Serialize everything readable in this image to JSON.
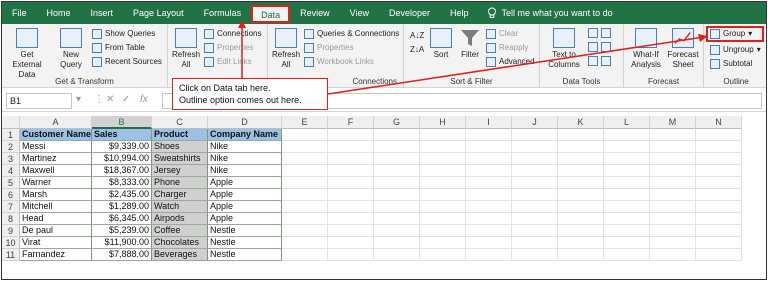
{
  "menu": {
    "tabs": [
      "File",
      "Home",
      "Insert",
      "Page Layout",
      "Formulas",
      "Data",
      "Review",
      "View",
      "Developer",
      "Help"
    ],
    "active_tab": "Data",
    "tell_me": "Tell me what you want to do"
  },
  "ribbon": {
    "get_transform": {
      "label": "Get & Transform",
      "get_external_data": "Get External Data",
      "new_query": "New Query",
      "show_queries": "Show Queries",
      "from_table": "From Table",
      "recent_sources": "Recent Sources"
    },
    "connections": {
      "label": "Connections",
      "refresh_all": "Refresh All",
      "connections": "Connections",
      "properties": "Properties",
      "edit_links": "Edit Links"
    },
    "queries": {
      "refresh_all": "Refresh All",
      "queries_connections": "Queries & Connections",
      "properties": "Properties",
      "workbook_links": "Workbook Links"
    },
    "sort_filter": {
      "label": "Sort & Filter",
      "sort": "Sort",
      "filter": "Filter",
      "clear": "Clear",
      "reapply": "Reapply",
      "advanced": "Advanced"
    },
    "data_tools": {
      "label": "Data Tools",
      "text_to_columns": "Text to Columns"
    },
    "forecast": {
      "label": "Forecast",
      "what_if": "What-If Analysis",
      "forecast_sheet": "Forecast Sheet"
    },
    "outline": {
      "label": "Outline",
      "group": "Group",
      "ungroup": "Ungroup",
      "subtotal": "Subtotal"
    }
  },
  "formula_bar": {
    "name_box": "B1",
    "fx": "fx",
    "value": ""
  },
  "callout": {
    "line1": "Click on Data tab here.",
    "line2": "Outline option comes out here."
  },
  "sheet": {
    "columns": [
      "A",
      "B",
      "C",
      "D",
      "E",
      "F",
      "G",
      "H",
      "I",
      "J",
      "K",
      "L",
      "M",
      "N"
    ],
    "rows": [
      "1",
      "2",
      "3",
      "4",
      "5",
      "6",
      "7",
      "8",
      "9",
      "10",
      "11"
    ],
    "headers": [
      "Customer Name",
      "Sales",
      "Product",
      "Company Name"
    ],
    "data": [
      [
        "Messi",
        "$9,339.00",
        "Shoes",
        "Nike"
      ],
      [
        "Martinez",
        "$10,994.00",
        "Sweatshirts",
        "Nike"
      ],
      [
        "Maxwell",
        "$18,367.00",
        "Jersey",
        "Nike"
      ],
      [
        "Warner",
        "$8,333.00",
        "Phone",
        "Apple"
      ],
      [
        "Marsh",
        "$2,435.00",
        "Charger",
        "Apple"
      ],
      [
        "Mitchell",
        "$1,289.00",
        "Watch",
        "Apple"
      ],
      [
        "Head",
        "$6,345.00",
        "Airpods",
        "Apple"
      ],
      [
        "De paul",
        "$5,239.00",
        "Coffee",
        "Nestle"
      ],
      [
        "Virat",
        "$11,900.00",
        "Chocolates",
        "Nestle"
      ],
      [
        "Farnandez",
        "$7,888.00",
        "Beverages",
        "Nestle"
      ]
    ]
  },
  "colors": {
    "excel_green": "#217346",
    "highlight_red": "#e0201b",
    "header_blue": "#9bc2e6",
    "product_gray": "#d0d0d0"
  }
}
